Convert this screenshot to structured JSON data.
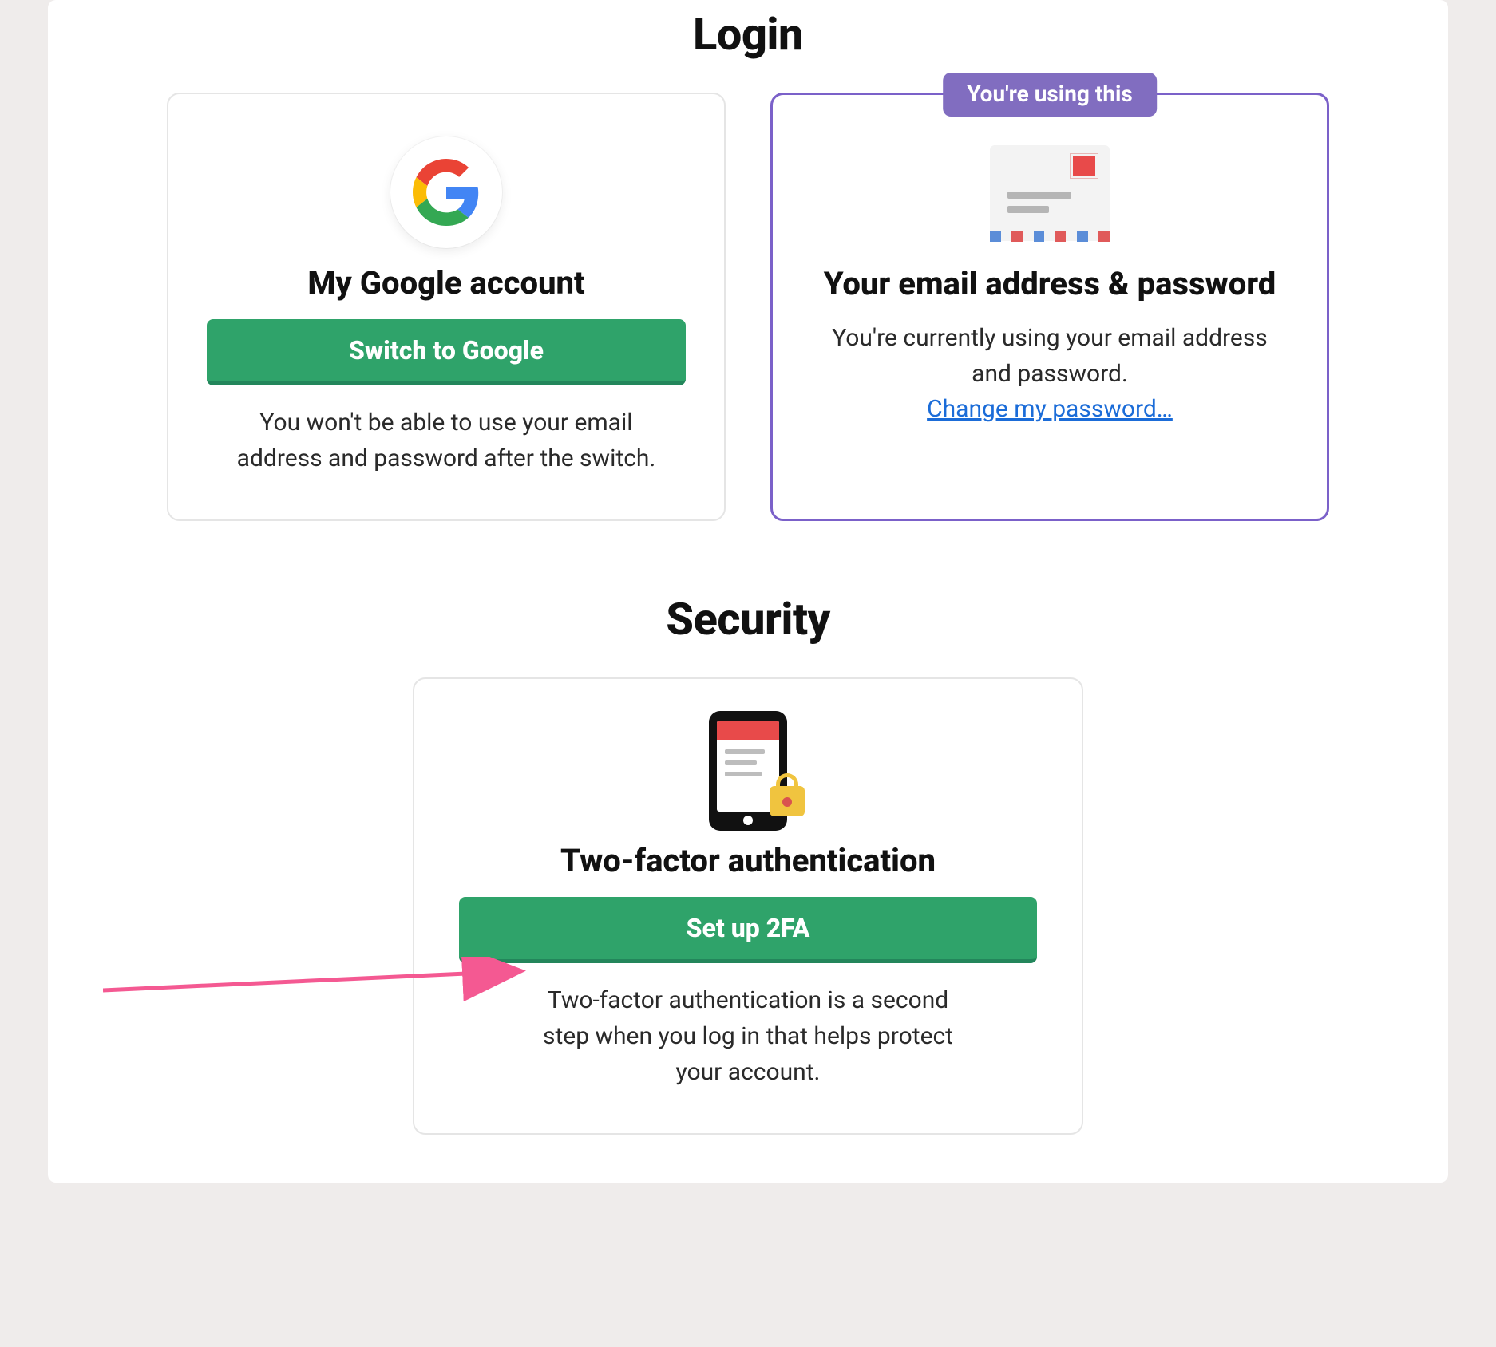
{
  "login": {
    "heading": "Login",
    "google": {
      "title": "My Google account",
      "button": "Switch to Google",
      "note": "You won't be able to use your email address and password after the switch."
    },
    "email": {
      "badge": "You're using this",
      "title": "Your email address & password",
      "note": "You're currently using your email address and password.",
      "change_link": "Change my password…"
    }
  },
  "security": {
    "heading": "Security",
    "twofa": {
      "title": "Two-factor authentication",
      "button": "Set up 2FA",
      "note": "Two-factor authentication is a second step when you log in that helps protect your account."
    }
  },
  "colors": {
    "accent_purple": "#7b61c9",
    "button_green": "#2fa36a",
    "link_blue": "#1b6cd8",
    "arrow_pink": "#f45992"
  }
}
